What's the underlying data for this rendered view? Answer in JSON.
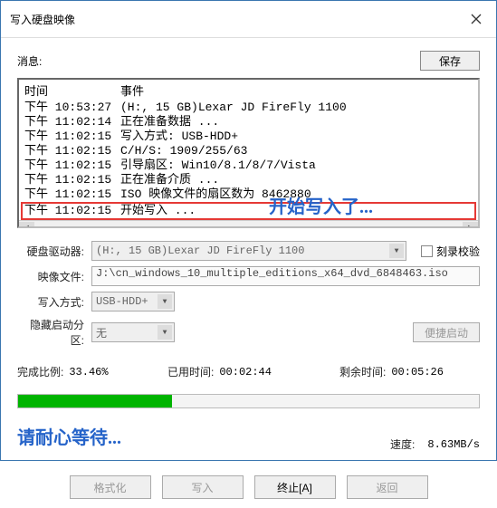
{
  "window": {
    "title": "写入硬盘映像"
  },
  "toolbar": {
    "messages_label": "消息:",
    "save_label": "保存"
  },
  "log": {
    "header_time": "时间",
    "header_event": "事件",
    "rows": [
      {
        "time": "下午 10:53:27",
        "event": "(H:, 15 GB)Lexar   JD FireFly    1100"
      },
      {
        "time": "下午 11:02:14",
        "event": "正在准备数据 ..."
      },
      {
        "time": "下午 11:02:15",
        "event": "写入方式: USB-HDD+"
      },
      {
        "time": "下午 11:02:15",
        "event": "C/H/S: 1909/255/63"
      },
      {
        "time": "下午 11:02:15",
        "event": "引导扇区: Win10/8.1/8/7/Vista"
      },
      {
        "time": "下午 11:02:15",
        "event": "正在准备介质 ..."
      },
      {
        "time": "下午 11:02:15",
        "event": "ISO 映像文件的扇区数为 8462880"
      },
      {
        "time": "下午 11:02:15",
        "event": "开始写入 ..."
      }
    ]
  },
  "annotations": {
    "start_writing": "开始写入了...",
    "please_wait": "请耐心等待..."
  },
  "form": {
    "drive_label": "硬盘驱动器:",
    "drive_value": "(H:, 15 GB)Lexar   JD FireFly    1100",
    "verify_label": "刻录校验",
    "image_label": "映像文件:",
    "image_value": "J:\\cn_windows_10_multiple_editions_x64_dvd_6848463.iso",
    "write_mode_label": "写入方式:",
    "write_mode_value": "USB-HDD+",
    "hidden_label": "隐藏启动分区:",
    "hidden_value": "无",
    "portable_btn": "便捷启动"
  },
  "progress": {
    "percent_label": "完成比例:",
    "percent_value": "33.46%",
    "elapsed_label": "已用时间:",
    "elapsed_value": "00:02:44",
    "remain_label": "剩余时间:",
    "remain_value": "00:05:26",
    "speed_label": "速度:",
    "speed_value": "8.63MB/s"
  },
  "buttons": {
    "format": "格式化",
    "write": "写入",
    "abort": "终止[A]",
    "back": "返回"
  }
}
